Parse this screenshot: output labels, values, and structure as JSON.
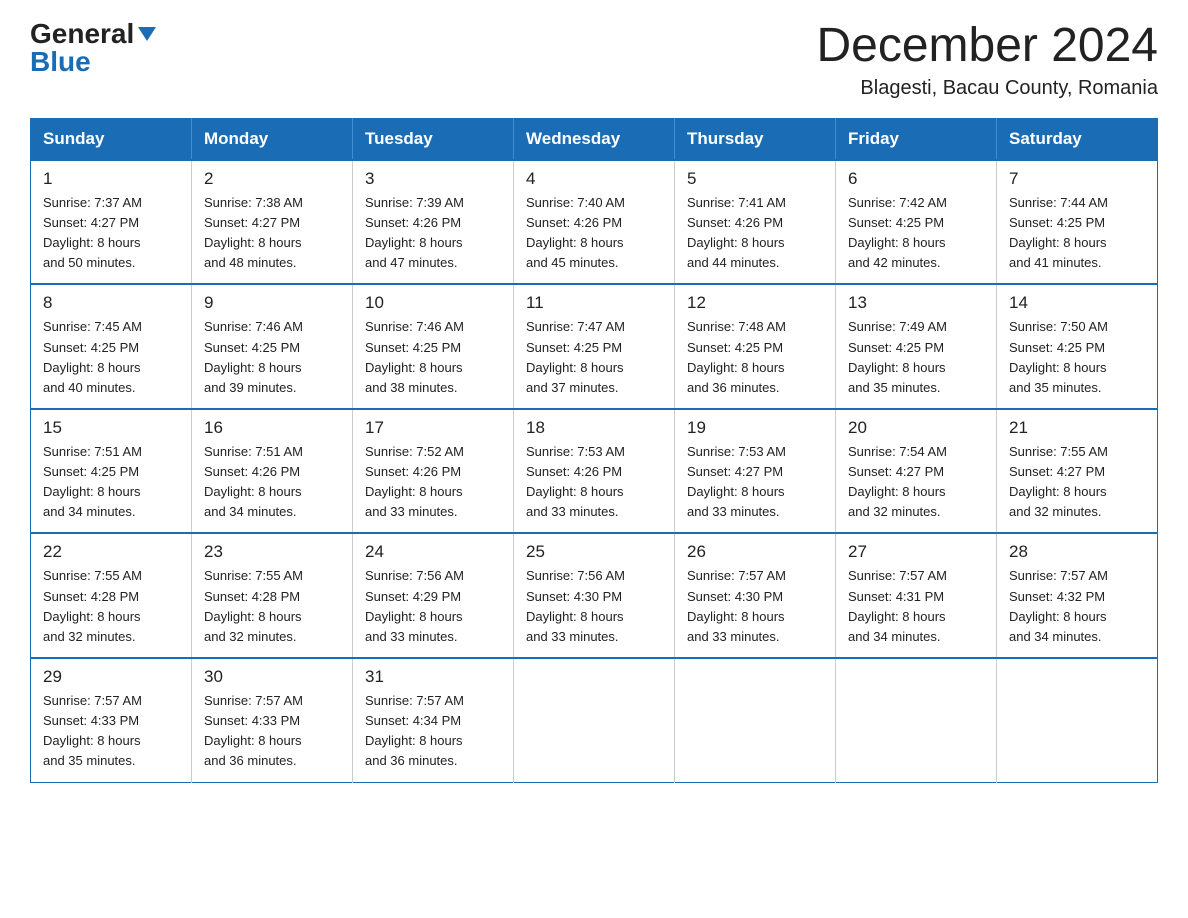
{
  "header": {
    "logo_general": "General",
    "logo_blue": "Blue",
    "month_title": "December 2024",
    "subtitle": "Blagesti, Bacau County, Romania"
  },
  "weekdays": [
    "Sunday",
    "Monday",
    "Tuesday",
    "Wednesday",
    "Thursday",
    "Friday",
    "Saturday"
  ],
  "weeks": [
    [
      {
        "day": "1",
        "sunrise": "7:37 AM",
        "sunset": "4:27 PM",
        "daylight_hours": "8",
        "daylight_minutes": "50"
      },
      {
        "day": "2",
        "sunrise": "7:38 AM",
        "sunset": "4:27 PM",
        "daylight_hours": "8",
        "daylight_minutes": "48"
      },
      {
        "day": "3",
        "sunrise": "7:39 AM",
        "sunset": "4:26 PM",
        "daylight_hours": "8",
        "daylight_minutes": "47"
      },
      {
        "day": "4",
        "sunrise": "7:40 AM",
        "sunset": "4:26 PM",
        "daylight_hours": "8",
        "daylight_minutes": "45"
      },
      {
        "day": "5",
        "sunrise": "7:41 AM",
        "sunset": "4:26 PM",
        "daylight_hours": "8",
        "daylight_minutes": "44"
      },
      {
        "day": "6",
        "sunrise": "7:42 AM",
        "sunset": "4:25 PM",
        "daylight_hours": "8",
        "daylight_minutes": "42"
      },
      {
        "day": "7",
        "sunrise": "7:44 AM",
        "sunset": "4:25 PM",
        "daylight_hours": "8",
        "daylight_minutes": "41"
      }
    ],
    [
      {
        "day": "8",
        "sunrise": "7:45 AM",
        "sunset": "4:25 PM",
        "daylight_hours": "8",
        "daylight_minutes": "40"
      },
      {
        "day": "9",
        "sunrise": "7:46 AM",
        "sunset": "4:25 PM",
        "daylight_hours": "8",
        "daylight_minutes": "39"
      },
      {
        "day": "10",
        "sunrise": "7:46 AM",
        "sunset": "4:25 PM",
        "daylight_hours": "8",
        "daylight_minutes": "38"
      },
      {
        "day": "11",
        "sunrise": "7:47 AM",
        "sunset": "4:25 PM",
        "daylight_hours": "8",
        "daylight_minutes": "37"
      },
      {
        "day": "12",
        "sunrise": "7:48 AM",
        "sunset": "4:25 PM",
        "daylight_hours": "8",
        "daylight_minutes": "36"
      },
      {
        "day": "13",
        "sunrise": "7:49 AM",
        "sunset": "4:25 PM",
        "daylight_hours": "8",
        "daylight_minutes": "35"
      },
      {
        "day": "14",
        "sunrise": "7:50 AM",
        "sunset": "4:25 PM",
        "daylight_hours": "8",
        "daylight_minutes": "35"
      }
    ],
    [
      {
        "day": "15",
        "sunrise": "7:51 AM",
        "sunset": "4:25 PM",
        "daylight_hours": "8",
        "daylight_minutes": "34"
      },
      {
        "day": "16",
        "sunrise": "7:51 AM",
        "sunset": "4:26 PM",
        "daylight_hours": "8",
        "daylight_minutes": "34"
      },
      {
        "day": "17",
        "sunrise": "7:52 AM",
        "sunset": "4:26 PM",
        "daylight_hours": "8",
        "daylight_minutes": "33"
      },
      {
        "day": "18",
        "sunrise": "7:53 AM",
        "sunset": "4:26 PM",
        "daylight_hours": "8",
        "daylight_minutes": "33"
      },
      {
        "day": "19",
        "sunrise": "7:53 AM",
        "sunset": "4:27 PM",
        "daylight_hours": "8",
        "daylight_minutes": "33"
      },
      {
        "day": "20",
        "sunrise": "7:54 AM",
        "sunset": "4:27 PM",
        "daylight_hours": "8",
        "daylight_minutes": "32"
      },
      {
        "day": "21",
        "sunrise": "7:55 AM",
        "sunset": "4:27 PM",
        "daylight_hours": "8",
        "daylight_minutes": "32"
      }
    ],
    [
      {
        "day": "22",
        "sunrise": "7:55 AM",
        "sunset": "4:28 PM",
        "daylight_hours": "8",
        "daylight_minutes": "32"
      },
      {
        "day": "23",
        "sunrise": "7:55 AM",
        "sunset": "4:28 PM",
        "daylight_hours": "8",
        "daylight_minutes": "32"
      },
      {
        "day": "24",
        "sunrise": "7:56 AM",
        "sunset": "4:29 PM",
        "daylight_hours": "8",
        "daylight_minutes": "33"
      },
      {
        "day": "25",
        "sunrise": "7:56 AM",
        "sunset": "4:30 PM",
        "daylight_hours": "8",
        "daylight_minutes": "33"
      },
      {
        "day": "26",
        "sunrise": "7:57 AM",
        "sunset": "4:30 PM",
        "daylight_hours": "8",
        "daylight_minutes": "33"
      },
      {
        "day": "27",
        "sunrise": "7:57 AM",
        "sunset": "4:31 PM",
        "daylight_hours": "8",
        "daylight_minutes": "34"
      },
      {
        "day": "28",
        "sunrise": "7:57 AM",
        "sunset": "4:32 PM",
        "daylight_hours": "8",
        "daylight_minutes": "34"
      }
    ],
    [
      {
        "day": "29",
        "sunrise": "7:57 AM",
        "sunset": "4:33 PM",
        "daylight_hours": "8",
        "daylight_minutes": "35"
      },
      {
        "day": "30",
        "sunrise": "7:57 AM",
        "sunset": "4:33 PM",
        "daylight_hours": "8",
        "daylight_minutes": "36"
      },
      {
        "day": "31",
        "sunrise": "7:57 AM",
        "sunset": "4:34 PM",
        "daylight_hours": "8",
        "daylight_minutes": "36"
      },
      null,
      null,
      null,
      null
    ]
  ],
  "labels": {
    "sunrise": "Sunrise:",
    "sunset": "Sunset:",
    "daylight": "Daylight:",
    "hours": "hours",
    "and": "and",
    "minutes": "minutes."
  }
}
